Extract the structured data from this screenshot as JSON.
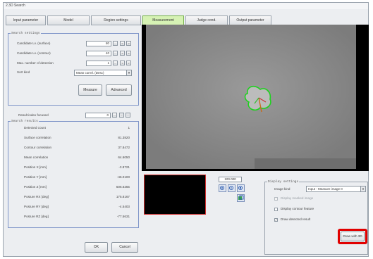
{
  "window": {
    "title": "2.3D Search"
  },
  "tabs": [
    {
      "label": "Input parameter",
      "active": false
    },
    {
      "label": "Model",
      "active": false
    },
    {
      "label": "Region settings",
      "active": false
    },
    {
      "label": "Measurement",
      "active": true
    },
    {
      "label": "Judge cond.",
      "active": false
    },
    {
      "label": "Output parameter",
      "active": false
    }
  ],
  "search_settings": {
    "title": "Search settings",
    "fields": [
      {
        "label": "Candidate Lv. (surface)",
        "value": "80"
      },
      {
        "label": "Candidate Lv. (contour)",
        "value": "40"
      },
      {
        "label": "Max. number of detection",
        "value": "1"
      }
    ],
    "sort_label": "Sort kind",
    "sort_value": "Mean correl. (Desc)",
    "measure_button": "Measure",
    "advanced_button": "Advanced"
  },
  "result_index": {
    "label": "Result index focused",
    "value": "0"
  },
  "search_results": {
    "title": "Search results",
    "rows": [
      {
        "label": "Detected count",
        "value": "1"
      },
      {
        "label": "Surface correlation",
        "value": "81.3820"
      },
      {
        "label": "Contour correlation",
        "value": "37.8472"
      },
      {
        "label": "Mean correlation",
        "value": "64.6050"
      },
      {
        "label": "Position X [mm]",
        "value": "-3.8721"
      },
      {
        "label": "Position Y [mm]",
        "value": "-46.0100"
      },
      {
        "label": "Position Z [mm]",
        "value": "506.6255"
      },
      {
        "label": "Posture RX [deg]",
        "value": "175.8167"
      },
      {
        "label": "Posture RY [deg]",
        "value": "-4.5403"
      },
      {
        "label": "Posture RZ [deg]",
        "value": "-77.5631"
      }
    ]
  },
  "footer": {
    "ok_label": "OK",
    "cancel_label": "Cancel"
  },
  "zoom": {
    "value": "100.000"
  },
  "display_settings": {
    "title": "Display settings",
    "image_kind_label": "Image kind",
    "image_kind_value": "Input - Measure image 0",
    "options": [
      {
        "label": "Display masked image",
        "checked": false,
        "enabled": false
      },
      {
        "label": "Display contour feature",
        "checked": false,
        "enabled": true
      },
      {
        "label": "Draw detected result",
        "checked": true,
        "enabled": true
      }
    ],
    "draw_with_3d": "Draw with 3D"
  },
  "colors": {
    "active_tab": "#d6f2b4",
    "group_border": "#7f95c9",
    "highlight": "#e10000",
    "viewer_bg": "#8c8c8c",
    "detected_outline": "#1fd11f"
  },
  "icons": [
    "zoom-in-icon",
    "zoom-out-icon",
    "zoom-fit-icon",
    "view-3d-icon",
    "dropdown-arrow-icon"
  ]
}
